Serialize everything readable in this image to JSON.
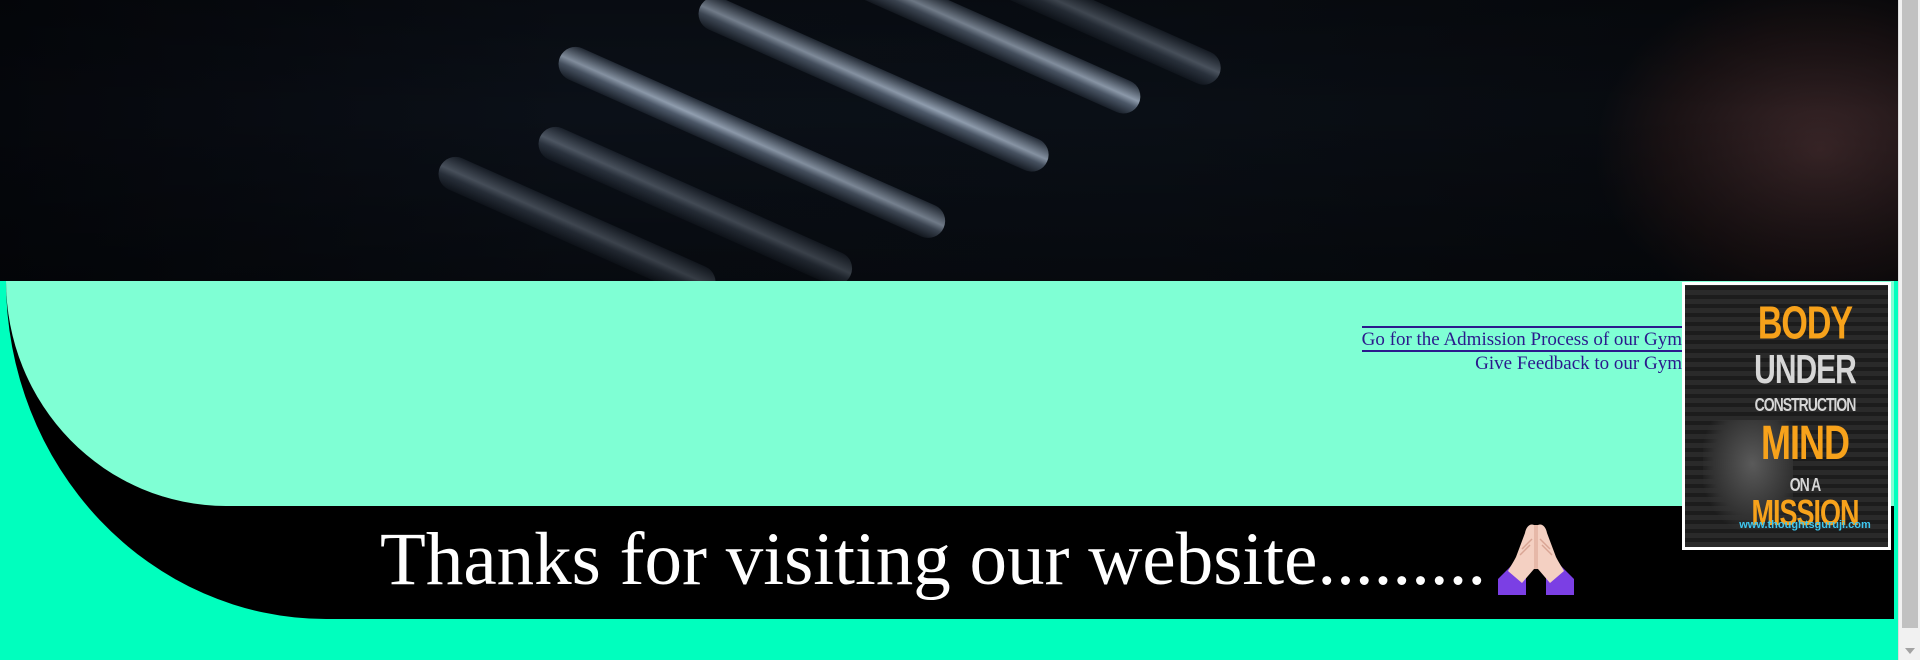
{
  "hero": {
    "image": "dumbbell-rack-photo"
  },
  "links": {
    "admission": "Go for the Admission Process of our Gym",
    "feedback": "Give Feedback to our Gym"
  },
  "footer": {
    "thanks_text": "Thanks for visiting our website.........",
    "emoji_icon": "folded-hands-icon"
  },
  "poster": {
    "line1": "BODY",
    "line2": "UNDER",
    "line3": "CONSTRUCTION",
    "line4": "MIND",
    "line5": "ON A",
    "line6": "MISSION",
    "url": "www.thoughtsguruji.com"
  },
  "colors": {
    "page_background": "#00ffbe",
    "panel": "#7fffd4",
    "band": "#000000",
    "link": "#2b1a8c",
    "poster_accent": "#f7a21b"
  }
}
